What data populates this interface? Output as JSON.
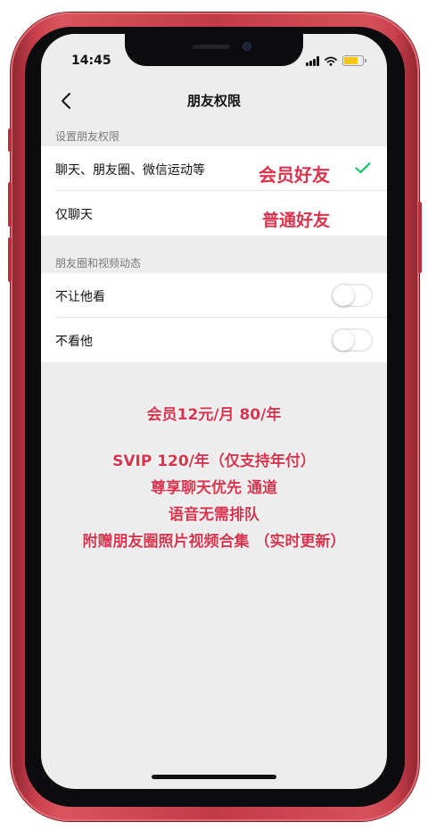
{
  "status_bar": {
    "time": "14:45"
  },
  "nav": {
    "title": "朋友权限",
    "back_icon": "chevron-left-icon"
  },
  "sections": [
    {
      "header": "设置朋友权限",
      "rows": [
        {
          "label": "聊天、朋友圈、微信运动等",
          "selected": true
        },
        {
          "label": "仅聊天",
          "selected": false
        }
      ]
    },
    {
      "header": "朋友圈和视频动态",
      "rows": [
        {
          "label": "不让他看",
          "toggle_on": false
        },
        {
          "label": "不看他",
          "toggle_on": false
        }
      ]
    }
  ],
  "overlay": {
    "tag_member": "会员好友",
    "tag_normal": "普通好友",
    "lines": [
      "会员12元/月  80/年",
      "SVIP 120/年（仅支持年付）",
      "尊享聊天优先 通道",
      "语音无需排队",
      "附赠朋友圈照片视频合集 （实时更新）"
    ],
    "color": "#d8344e"
  },
  "colors": {
    "check": "#07c160",
    "phone_frame": "#c23a47",
    "battery": "#f2c516"
  }
}
